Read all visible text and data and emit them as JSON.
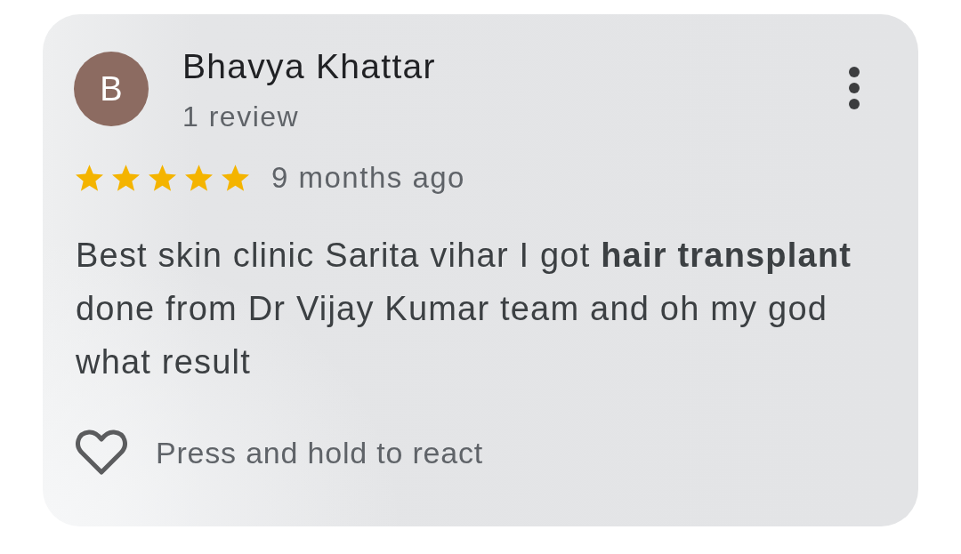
{
  "review": {
    "avatar_initial": "B",
    "name": "Bhavya Khattar",
    "review_count": "1 review",
    "stars": 5,
    "time": "9 months ago",
    "text": "Best skin clinic Sarita vihar I got **hair transplant** done from Dr Vijay Kumar team and oh my god what result",
    "react_hint": "Press and hold to react"
  }
}
